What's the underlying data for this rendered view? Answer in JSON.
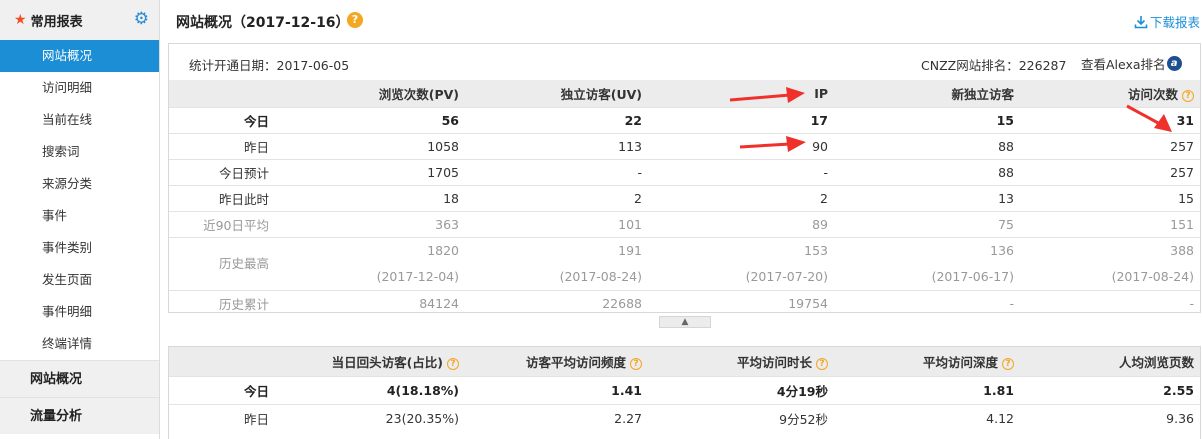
{
  "sidebar": {
    "header_label": "常用报表",
    "items": [
      "网站概况",
      "访问明细",
      "当前在线",
      "搜索词",
      "来源分类",
      "事件",
      "事件类别",
      "发生页面",
      "事件明细",
      "终端详情"
    ],
    "groups": [
      "网站概况",
      "流量分析"
    ]
  },
  "header": {
    "title": "网站概况（2017-12-16）",
    "help": "?",
    "download_label": "下载报表"
  },
  "info": {
    "since": "统计开通日期：2017-06-05",
    "rank": "CNZZ网站排名：226287",
    "alexa_label": "查看Alexa排名",
    "alexa_logo": "a"
  },
  "table1": {
    "headers": [
      "",
      "浏览次数(PV)",
      "独立访客(UV)",
      "IP",
      "新独立访客",
      "访问次数"
    ],
    "rows": [
      {
        "label": "今日",
        "values": [
          "56",
          "22",
          "17",
          "15",
          "31"
        ]
      },
      {
        "label": "昨日",
        "values": [
          "1058",
          "113",
          "90",
          "88",
          "257"
        ]
      },
      {
        "label": "今日预计",
        "values": [
          "1705",
          "-",
          "-",
          "88",
          "257"
        ]
      },
      {
        "label": "昨日此时",
        "values": [
          "18",
          "2",
          "2",
          "13",
          "15"
        ]
      },
      {
        "label": "近90日平均",
        "values": [
          "363",
          "101",
          "89",
          "75",
          "151"
        ]
      },
      {
        "label": "历史最高",
        "values": [
          "1820",
          "191",
          "153",
          "136",
          "388"
        ],
        "dates": [
          "(2017-12-04)",
          "(2017-08-24)",
          "(2017-07-20)",
          "(2017-06-17)",
          "(2017-08-24)"
        ]
      },
      {
        "label": "历史累计",
        "values": [
          "84124",
          "22688",
          "19754",
          "-",
          "-"
        ]
      }
    ]
  },
  "collapse_glyph": "▲",
  "table2": {
    "headers": [
      "",
      "当日回头访客(占比)",
      "访客平均访问频度",
      "平均访问时长",
      "平均访问深度",
      "人均浏览页数"
    ],
    "rows": [
      {
        "label": "今日",
        "values": [
          "4(18.18%)",
          "1.41",
          "4分19秒",
          "1.81",
          "2.55"
        ]
      },
      {
        "label": "昨日",
        "values": [
          "23(20.35%)",
          "2.27",
          "9分52秒",
          "4.12",
          "9.36"
        ]
      }
    ]
  },
  "colors": {
    "accent": "#1b8ed6",
    "help": "#f5a623",
    "arrow": "#f0302a",
    "star": "#f04e23"
  }
}
